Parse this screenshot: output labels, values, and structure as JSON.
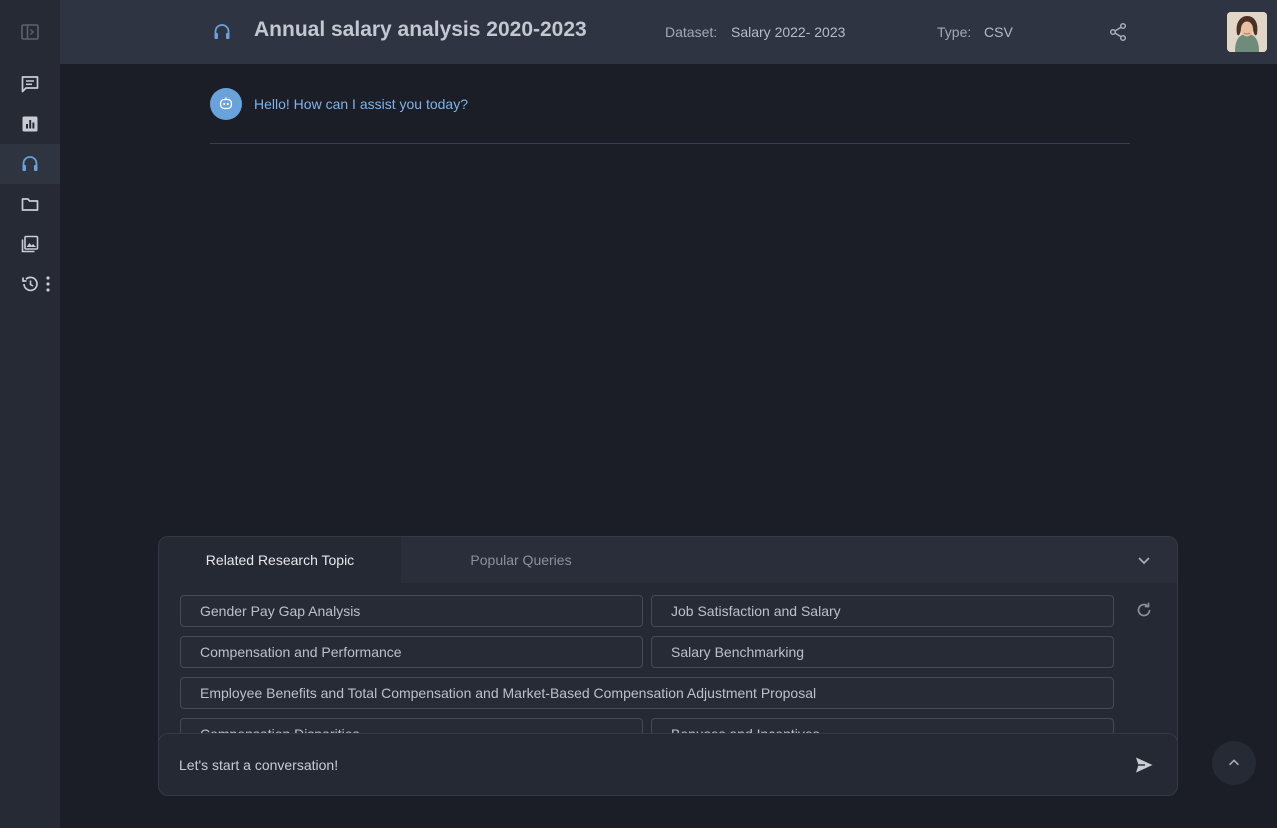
{
  "header": {
    "title": "Annual salary analysis 2020-2023",
    "dataset_label": "Dataset:",
    "dataset_value": "Salary 2022- 2023",
    "type_label": "Type:",
    "type_value": "CSV"
  },
  "sidebar": {
    "items": [
      {
        "icon": "sidebar-toggle-icon"
      },
      {
        "icon": "chat-icon"
      },
      {
        "icon": "chart-icon"
      },
      {
        "icon": "headset-icon",
        "active": true
      },
      {
        "icon": "folder-icon"
      },
      {
        "icon": "gallery-icon"
      },
      {
        "icon": "history-icon"
      }
    ]
  },
  "chat": {
    "greeting": "Hello! How can I assist you today?"
  },
  "suggestions": {
    "tabs": [
      "Related Research Topic",
      "Popular Queries"
    ],
    "topics": [
      "Gender Pay Gap Analysis",
      "Job Satisfaction and Salary",
      "Compensation and Performance",
      "Salary Benchmarking",
      "Employee Benefits and Total Compensation and Market-Based Compensation Adjustment Proposal",
      "Compensation Disparities",
      "Bonuses and Incentives"
    ]
  },
  "input": {
    "placeholder": "Let's start a conversation!"
  },
  "colors": {
    "accent": "#6aa3dc",
    "sidebar_bg": "#262a35",
    "header_bg": "#2e3442",
    "page_bg": "#1b1e27"
  }
}
